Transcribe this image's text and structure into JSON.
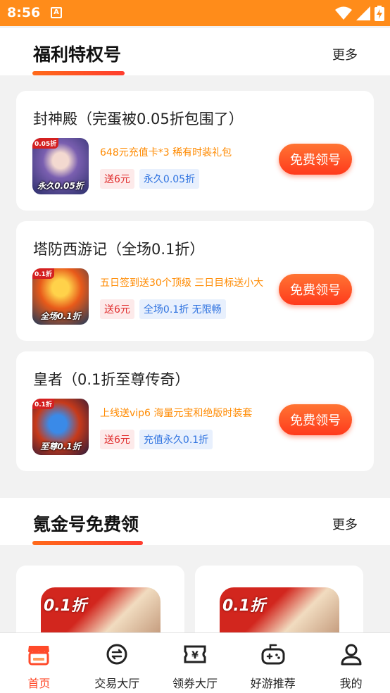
{
  "status_bar": {
    "time": "8:56",
    "notification_icon": "a-square-icon",
    "icons": [
      "wifi-icon",
      "signal-icon",
      "battery-icon"
    ]
  },
  "section1": {
    "title": "福利特权号",
    "more": "更多"
  },
  "cards": [
    {
      "name": "封神殿（完蛋被0.05折包围了）",
      "badge": "0.05折",
      "thumb_caption": "永久0.05折",
      "desc": "648元充值卡*3  稀有时装礼包",
      "tag_red": "送6元",
      "tag_blue": "永久0.05折",
      "button": "免费领号"
    },
    {
      "name": "塔防西游记（全场0.1折）",
      "badge": "0.1折",
      "thumb_caption": "全场0.1折",
      "desc": "五日签到送30个顶级  三日目标送小大",
      "tag_red": "送6元",
      "tag_blue": "全场0.1折 无限畅",
      "button": "免费领号"
    },
    {
      "name": "皇者（0.1折至尊传奇）",
      "badge": "0.1折",
      "thumb_caption": "至尊0.1折",
      "desc": "上线送vip6  海量元宝和绝版时装套",
      "tag_red": "送6元",
      "tag_blue": "充值永久0.1折",
      "button": "免费领号"
    }
  ],
  "section2": {
    "title": "氪金号免费领",
    "more": "更多"
  },
  "grid_items": [
    {
      "badge": "0.1折"
    },
    {
      "badge": "0.1折"
    }
  ],
  "tabbar": [
    {
      "label": "首页",
      "icon": "home-store-icon",
      "active": true
    },
    {
      "label": "交易大厅",
      "icon": "trade-icon",
      "active": false
    },
    {
      "label": "领券大厅",
      "icon": "coupon-icon",
      "active": false
    },
    {
      "label": "好游推荐",
      "icon": "gamepad-icon",
      "active": false
    },
    {
      "label": "我的",
      "icon": "user-icon",
      "active": false
    }
  ],
  "colors": {
    "status_bar": "#ff8c1a",
    "accent": "#ff4a2a",
    "desc_text": "#ff8a00",
    "tag_red": "#e02b2b",
    "tag_blue": "#2f73e0"
  }
}
